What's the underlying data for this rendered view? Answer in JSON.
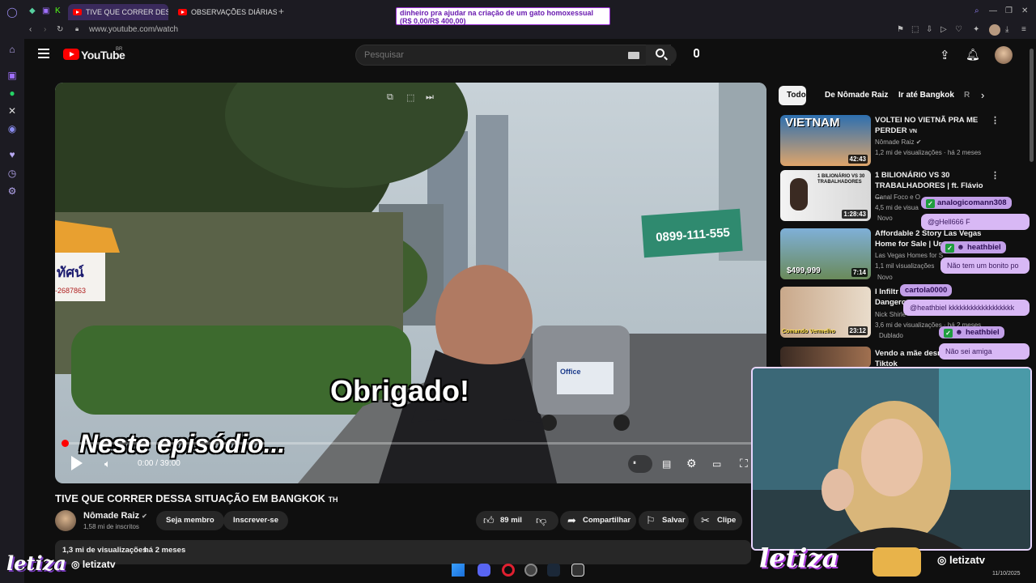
{
  "browser": {
    "tabs": [
      {
        "label": "TIVE QUE CORRER DESSA"
      },
      {
        "label": "OBSERVAÇÕES DIÁRIAS"
      }
    ],
    "url": "www.youtube.com/watch",
    "new_tab": "+"
  },
  "donation": {
    "line1": "dinheiro pra ajudar na criação de um gato homoxessual",
    "line2": "(R$ 0,00/R$ 400,00)"
  },
  "youtube": {
    "logo_text": "YouTube",
    "region": "BR",
    "search_placeholder": "Pesquisar"
  },
  "video": {
    "subtitle_big": "Obrigado!",
    "subtitle_small": "Neste episódio...",
    "sign_text": "0899-111-555",
    "shop_text": "ทัศน์",
    "shop_phone": "-2687863",
    "tuk_tuk_text": "Office",
    "time": "0:00 / 39:00",
    "progress": 0
  },
  "video_info": {
    "title": "TIVE QUE CORRER DESSA SITUAÇÃO EM BANGKOK",
    "title_flag": "TH",
    "channel_name": "Nômade Raiz",
    "subscribers": "1,58 mi de inscritos",
    "member_button": "Seja membro",
    "subscribe_button": "Inscrever-se",
    "likes": "89 mil",
    "share_label": "Compartilhar",
    "save_label": "Salvar",
    "clip_label": "Clipe",
    "views": "1,3 mi de visualizações",
    "age": "há 2 meses"
  },
  "chips": [
    "Todos",
    "De Nômade Raiz",
    "Ir até Bangkok",
    "R"
  ],
  "recommendations": [
    {
      "title": "VOLTEI NO VIETNÃ PRA ME PERDER",
      "flag": "VN",
      "channel": "Nômade Raiz",
      "meta": "1,2 mi de visualizações · há 2 meses",
      "duration": "42:43",
      "thumb_text": "VIETNAM",
      "badge": ""
    },
    {
      "title": "1 BILIONÁRIO VS 30 TRABALHADORES | ft. Flávio ...",
      "channel": "Canal Foco e O",
      "meta": "4,5 mi de visua",
      "duration": "1:28:43",
      "thumb_text": "1 BILIONÁRIO VS 30 TRABALHADORES",
      "badge": "Novo"
    },
    {
      "title": "Affordable 2 Story Las Vegas Home for Sale | Ur",
      "channel": "Las Vegas Homes for S",
      "meta": "1,1 mil visualizações",
      "duration": "7:14",
      "thumb_text": "$499,999",
      "badge": "Novo"
    },
    {
      "title": "I Infiltr Dangero",
      "channel": "Nick Shirle",
      "meta": "3,6 mi de visualizações · há 2 meses",
      "duration": "23:12",
      "thumb_text": "Comando Vermelho",
      "badge": "Dublado"
    },
    {
      "title": "Vendo a mãe desnet Tiktok",
      "channel": "",
      "meta": "",
      "duration": "",
      "thumb_text": "",
      "badge": ""
    }
  ],
  "chat": [
    {
      "user": "analogicomann308",
      "message": "@gHell666 F"
    },
    {
      "user": "heathbiel",
      "message": "Não tem um bonito po"
    },
    {
      "user": "cartola0000",
      "message": "@heathbiel kkkkkkkkkkkkkkkkkk"
    },
    {
      "user": "heathbiel",
      "message": "Não sei amiga"
    }
  ],
  "stream": {
    "brand_left": "letiza",
    "handle_left": "letizatv",
    "brand_right": "letiza",
    "handle_right": "letizatv",
    "clock_date": "11/10/2025"
  },
  "colors": {
    "youtube_red": "#ff0000",
    "chat_name_bg": "#c29fe8",
    "chat_msg_bg": "#d8b8f5",
    "brand_purple": "#b7a8f2"
  }
}
